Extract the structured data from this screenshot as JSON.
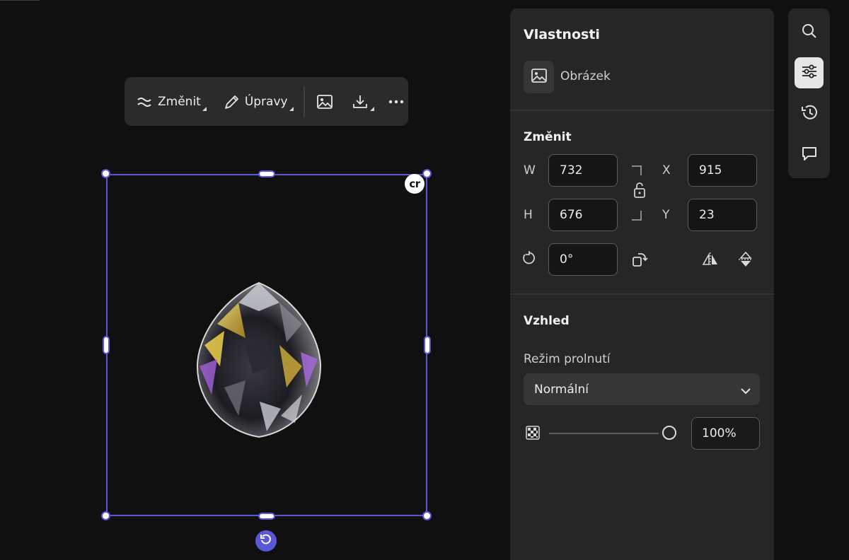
{
  "toolbar": {
    "change_label": "Změnit",
    "edits_label": "Úpravy"
  },
  "canvas": {
    "badge_text": "cr"
  },
  "properties": {
    "title": "Vlastnosti",
    "layer_type": "Obrázek",
    "transform": {
      "heading": "Změnit",
      "w_label": "W",
      "w_value": "732",
      "h_label": "H",
      "h_value": "676",
      "x_label": "X",
      "x_value": "915",
      "y_label": "Y",
      "y_value": "23",
      "rotation_value": "0°"
    },
    "appearance": {
      "heading": "Vzhled",
      "blend_label": "Režim prolnutí",
      "blend_value": "Normální",
      "opacity_value": "100%",
      "opacity_level": 1.0
    }
  },
  "rail": {
    "items": [
      "search-icon",
      "adjustments-icon",
      "history-icon",
      "comment-icon"
    ],
    "active": "adjustments-icon"
  },
  "colors": {
    "selection": "#5a57d8",
    "panel": "#262626",
    "background": "#101010"
  }
}
